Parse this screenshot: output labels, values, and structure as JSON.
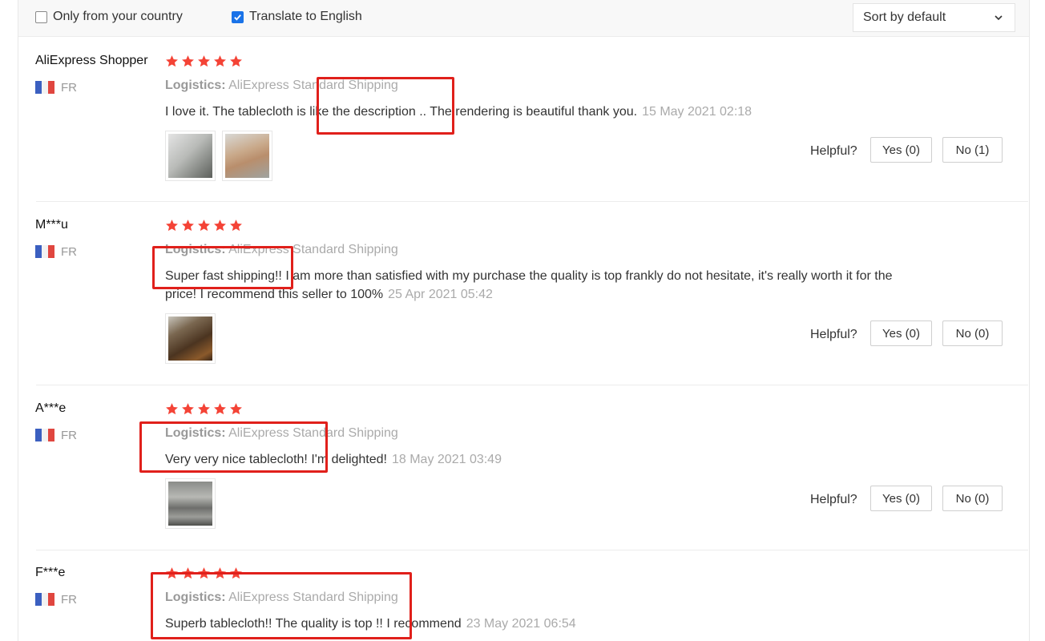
{
  "filters": {
    "country_label": "Only from your country",
    "country_checked": false,
    "translate_label": "Translate to English",
    "translate_checked": true
  },
  "sort": {
    "label": "Sort by default"
  },
  "helpful_label": "Helpful?",
  "colors": {
    "star": "#f44336",
    "highlight": "#e0201b",
    "checkbox": "#1a73e8"
  },
  "reviews": [
    {
      "user": "AliExpress Shopper",
      "country": "FR",
      "rating": 5,
      "logistics_label": "Logistics:",
      "logistics_value": "AliExpress Standard Shipping",
      "text": "I love it. The tablecloth is like the description .. The rendering is beautiful thank you.",
      "date": "15 May 2021 02:18",
      "yes": "Yes (0)",
      "no": "No (1)"
    },
    {
      "user": "M***u",
      "country": "FR",
      "rating": 5,
      "logistics_label": "Logistics:",
      "logistics_value": "AliExpress Standard Shipping",
      "text": "Super fast shipping!! I am more than satisfied with my purchase the quality is top frankly do not hesitate, it's really worth it for the price! I recommend this seller to 100%",
      "date": "25 Apr 2021 05:42",
      "yes": "Yes (0)",
      "no": "No (0)"
    },
    {
      "user": "A***e",
      "country": "FR",
      "rating": 5,
      "logistics_label": "Logistics:",
      "logistics_value": "AliExpress Standard Shipping",
      "text": "Very very nice tablecloth! I'm delighted!",
      "date": "18 May 2021 03:49",
      "yes": "Yes (0)",
      "no": "No (0)"
    },
    {
      "user": "F***e",
      "country": "FR",
      "rating": 5,
      "logistics_label": "Logistics:",
      "logistics_value": "AliExpress Standard Shipping",
      "text": "Superb tablecloth!! The quality is top !! I recommend",
      "date": "23 May 2021 06:54"
    }
  ]
}
